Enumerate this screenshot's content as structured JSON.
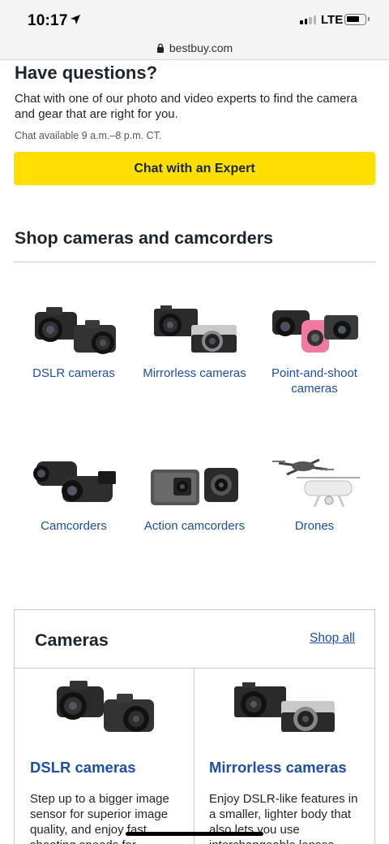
{
  "status_bar": {
    "time": "10:17",
    "network": "LTE"
  },
  "browser": {
    "url": "bestbuy.com"
  },
  "questions": {
    "title": "Have questions?",
    "body": "Chat with one of our photo and video experts to find the camera and gear that are right for you.",
    "hours": "Chat available 9 a.m.–8 p.m. CT.",
    "chat_button": "Chat with an Expert"
  },
  "shop": {
    "title": "Shop cameras and camcorders",
    "categories": [
      {
        "label": "DSLR cameras",
        "icon": "dslr-camera-icon"
      },
      {
        "label": "Mirrorless cameras",
        "icon": "mirrorless-camera-icon"
      },
      {
        "label": "Point-and-shoot cameras",
        "icon": "point-and-shoot-camera-icon"
      },
      {
        "label": "Camcorders",
        "icon": "camcorder-icon"
      },
      {
        "label": "Action camcorders",
        "icon": "action-camera-icon"
      },
      {
        "label": "Drones",
        "icon": "drone-icon"
      }
    ]
  },
  "cameras_card": {
    "title": "Cameras",
    "shop_all": "Shop all",
    "products": [
      {
        "title": "DSLR cameras",
        "desc": "Step up to a bigger image sensor for superior image quality, and enjoy fast shooting speeds for"
      },
      {
        "title": "Mirrorless cameras",
        "desc": "Enjoy DSLR-like features in a smaller, lighter body that also lets you use interchangeable lenses."
      }
    ]
  },
  "colors": {
    "accent_yellow": "#ffe000",
    "link_blue": "#1f4ea3",
    "text": "#1d252c"
  }
}
